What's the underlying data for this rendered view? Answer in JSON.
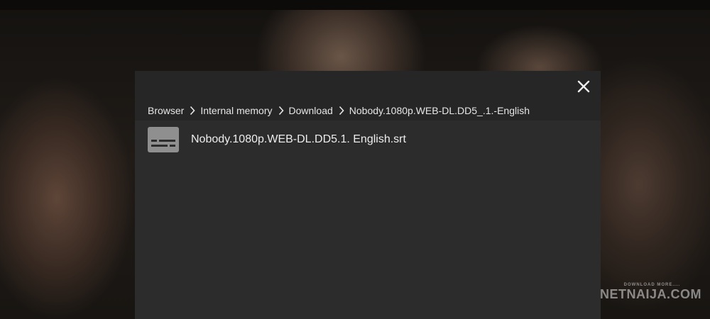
{
  "breadcrumb": [
    {
      "label": "Browser"
    },
    {
      "label": "Internal memory"
    },
    {
      "label": "Download"
    },
    {
      "label": "Nobody.1080p.WEB-DL.DD5_.1.-English"
    }
  ],
  "files": [
    {
      "name": "Nobody.1080p.WEB-DL.DD5.1. English.srt",
      "icon": "subtitles-file-icon"
    }
  ],
  "watermark": {
    "tagline": "DOWNLOAD MORE....",
    "brand": "NETNAIJA.COM"
  },
  "colors": {
    "dialog_bg": "#2c2c2c",
    "header_bg": "#262626",
    "text": "#e6e6e6",
    "icon": "#8f8f8f"
  }
}
